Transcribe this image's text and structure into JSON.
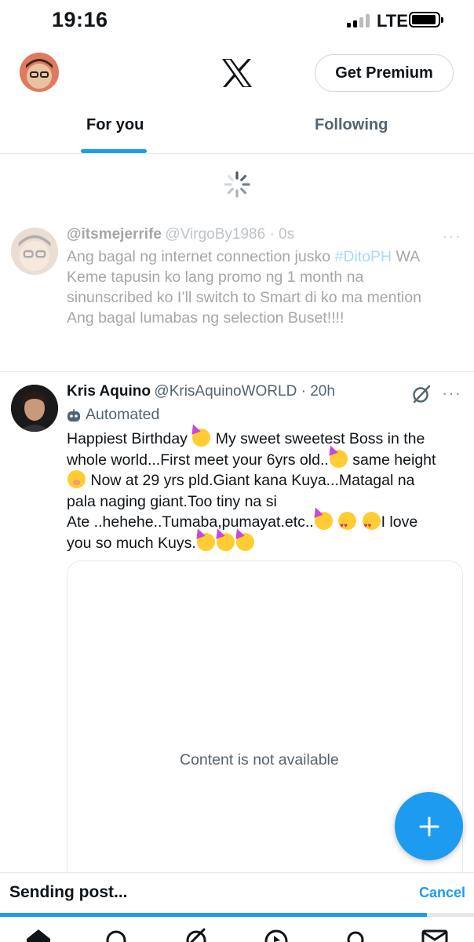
{
  "status_bar": {
    "time": "19:16",
    "network": "LTE"
  },
  "header": {
    "premium_label": "Get Premium"
  },
  "tabs": [
    {
      "label": "For you",
      "active": true
    },
    {
      "label": "Following",
      "active": false
    }
  ],
  "pending_tweet": {
    "name": "@itsmejerrife",
    "handle_time": "@VirgoBy1986 · 0s",
    "body_prefix": "Ang bagal ng internet connection jusko ",
    "hashtag": "#DitoPH",
    "body_suffix": " WA",
    "lines": [
      "Keme tapusin ko lang promo ng 1 month na",
      "sinunscribed ko I’ll switch to Smart di ko ma mention",
      "Ang bagal lumabas ng selection Buset!!!!"
    ],
    "more": "···"
  },
  "tweet": {
    "name": "Kris Aquino",
    "handle_time": "@KrisAquinoWORLD · 20h",
    "automated_label": "Automated",
    "more": "···",
    "line1_a": "Happiest Birthday ",
    "line1_b": " My sweet sweetest Boss in the",
    "line2_a": "whole world...First meet your 6yrs old..",
    "line2_b": " same height",
    "line3": "Now at 29 yrs pld.Giant kana Kuya...Matagal na",
    "line4": "pala naging giant.Too tiny na si",
    "line5_a": "Ate ..hehehe..Tumaba,pumayat.etc..",
    "line5_b": "I love",
    "line6": "you so much Kuys.",
    "media_text": "Content is not available"
  },
  "sending": {
    "label": "Sending post...",
    "cancel_label": "Cancel",
    "progress": 0.9
  },
  "colors": {
    "accent": "#1d9bf0",
    "text": "#0f1419",
    "secondary": "#536471"
  },
  "icons": [
    "signal-icon",
    "battery-icon",
    "x-logo-icon",
    "loading-spinner-icon",
    "more-icon",
    "grok-icon",
    "robot-icon",
    "compose-plus-icon",
    "home-icon",
    "search-icon",
    "grok-nav-icon",
    "play-icon",
    "communities-icon",
    "messages-icon"
  ]
}
